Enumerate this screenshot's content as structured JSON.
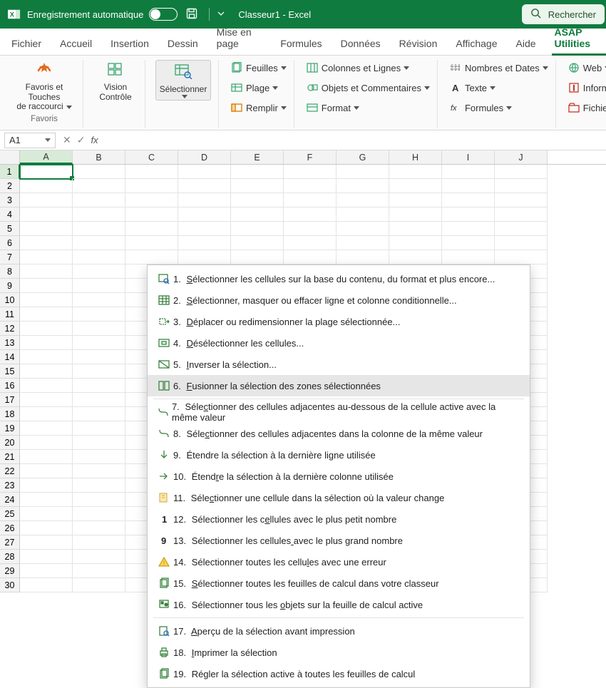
{
  "titlebar": {
    "autosave": "Enregistrement automatique",
    "workbook": "Classeur1  -  Excel",
    "search": "Rechercher"
  },
  "tabs": [
    "Fichier",
    "Accueil",
    "Insertion",
    "Dessin",
    "Mise en page",
    "Formules",
    "Données",
    "Révision",
    "Affichage",
    "Aide",
    "ASAP Utilities"
  ],
  "active_tab": 10,
  "ribbon": {
    "favoris_line1": "Favoris et Touches",
    "favoris_line2": "de raccourci",
    "favoris_group": "Favoris",
    "vision_line1": "Vision",
    "vision_line2": "Contrôle",
    "selectionner": "Sélectionner",
    "feuilles": "Feuilles",
    "plage": "Plage",
    "remplir": "Remplir",
    "colonnes": "Colonnes et Lignes",
    "objets": "Objets et Commentaires",
    "format": "Format",
    "nombres": "Nombres et Dates",
    "texte": "Texte",
    "formules": "Formules",
    "web": "Web",
    "informations": "Informations",
    "fichier_sys": "Fichier et Système"
  },
  "fbar": {
    "activecell": "A1"
  },
  "grid": {
    "cols": [
      "A",
      "B",
      "C",
      "D",
      "E",
      "F",
      "G",
      "H",
      "I",
      "J"
    ],
    "rows": 30,
    "sel_col_index": 0,
    "sel_row_index": 0
  },
  "menu": {
    "highlighted_index": 5,
    "items": [
      {
        "n": "1",
        "text": "Sélectionner les cellules sur la base du contenu, du format et plus encore...",
        "u": 0,
        "ic": "find"
      },
      {
        "n": "2",
        "text": "Sélectionner, masquer ou effacer ligne et colonne conditionnelle...",
        "u": 0,
        "ic": "grid"
      },
      {
        "n": "3",
        "text": "Déplacer ou redimensionner la plage sélectionnée...",
        "u": 0,
        "ic": "move"
      },
      {
        "n": "4",
        "text": "Désélectionner les cellules...",
        "u": 0,
        "ic": "desel"
      },
      {
        "n": "5",
        "text": "Inverser la sélection...",
        "u": 0,
        "ic": "inv"
      },
      {
        "n": "6",
        "text": "Fusionner la sélection des zones sélectionnées",
        "u": 0,
        "ic": "merge"
      },
      {
        "n": "7",
        "text": "Sélectionner des cellules adjacentes au-dessous de la cellule active avec la même valeur",
        "u": 4,
        "ic": "curve"
      },
      {
        "n": "8",
        "text": "Sélectionner des cellules adjacentes dans la colonne de la même valeur",
        "u": 4,
        "ic": "curve"
      },
      {
        "n": "9",
        "text": "Étendre la sélection à la dernière ligne utilisée",
        "u": -1,
        "ic": "down"
      },
      {
        "n": "10",
        "text": "Étendre la sélection à la dernière colonne utilisée",
        "u": 5,
        "ic": "right"
      },
      {
        "n": "11",
        "text": "Sélectionner une cellule dans la sélection où la valeur change",
        "u": 4,
        "ic": "change"
      },
      {
        "n": "12",
        "text": "Sélectionner les cellules avec le plus petit nombre",
        "u": 18,
        "ic": "one"
      },
      {
        "n": "13",
        "text": "Sélectionner les cellules avec le plus grand nombre",
        "u": 25,
        "ic": "nine"
      },
      {
        "n": "14",
        "text": "Sélectionner toutes les cellules avec une erreur",
        "u": 29,
        "ic": "warn"
      },
      {
        "n": "15",
        "text": "Sélectionner toutes les feuilles de calcul dans votre classeur",
        "u": 0,
        "ic": "sheets"
      },
      {
        "n": "16",
        "text": "Sélectionner tous les objets sur la feuille de calcul active",
        "u": 22,
        "ic": "obj"
      },
      {
        "n": "17",
        "text": "Aperçu de la sélection avant impression",
        "u": 0,
        "ic": "preview"
      },
      {
        "n": "18",
        "text": "Imprimer la sélection",
        "u": 0,
        "ic": "print"
      },
      {
        "n": "19",
        "text": "Régler la sélection active à toutes les feuilles de calcul",
        "u": -1,
        "ic": "sheets"
      }
    ]
  }
}
